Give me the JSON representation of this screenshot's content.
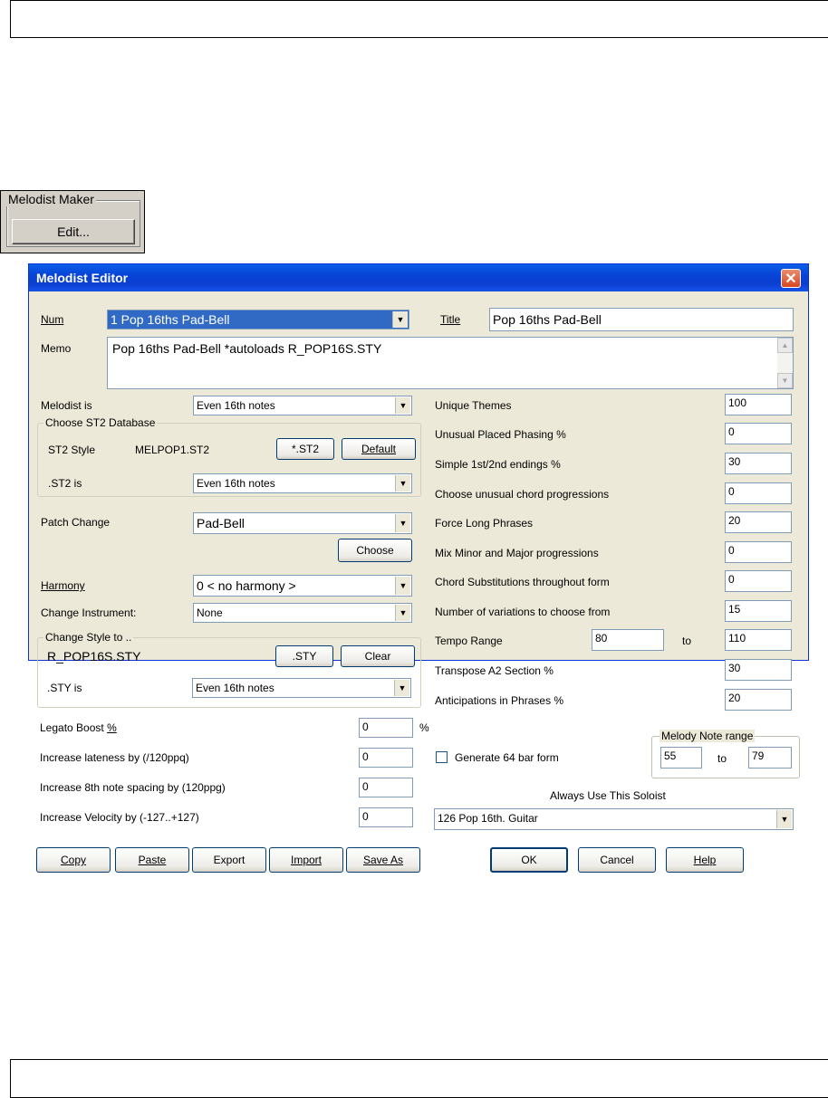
{
  "maker": {
    "legend": "Melodist Maker",
    "edit_label": "Edit..."
  },
  "dialog": {
    "title": "Melodist Editor",
    "close_glyph": "✕",
    "num": {
      "label": "Num",
      "value": "1 Pop 16ths Pad-Bell"
    },
    "title_field": {
      "label": "Title",
      "value": "Pop 16ths Pad-Bell"
    },
    "memo": {
      "label": "Memo",
      "value": "Pop 16ths Pad-Bell   *autoloads R_POP16S.STY"
    },
    "melodist_is": {
      "label": "Melodist is",
      "value": "Even 16th notes"
    },
    "st2": {
      "legend": "Choose ST2 Database",
      "style_label": "ST2 Style",
      "style_value": "MELPOP1.ST2",
      "st2_button": "*.ST2",
      "default_button": "Default",
      "is_label": ".ST2 is",
      "is_value": "Even 16th notes"
    },
    "patch": {
      "label": "Patch Change",
      "value": "Pad-Bell",
      "choose_button": "Choose"
    },
    "harmony": {
      "label": "Harmony",
      "value": "0 < no harmony >"
    },
    "change_instrument": {
      "label": "Change Instrument:",
      "value": "None"
    },
    "style": {
      "legend": "Change Style to ..",
      "value": "R_POP16S.STY",
      "sty_button": ".STY",
      "clear_button": "Clear",
      "is_label": ".STY is",
      "is_value": "Even 16th notes"
    },
    "legato": {
      "label": "Legato Boost %",
      "value": "0",
      "suffix": "%"
    },
    "lateness": {
      "label": "Increase lateness by (/120ppq)",
      "value": "0"
    },
    "spacing": {
      "label": "Increase 8th note spacing by (120ppg)",
      "value": "0"
    },
    "velocity": {
      "label": "Increase Velocity by (-127..+127)",
      "value": "0"
    },
    "right": {
      "unique_themes": {
        "label": "Unique Themes",
        "value": "100"
      },
      "unusual_phasing": {
        "label": "Unusual Placed Phasing %",
        "value": "0"
      },
      "simple_endings": {
        "label": "Simple 1st/2nd endings %",
        "value": "30"
      },
      "unusual_chords": {
        "label": "Choose unusual chord progressions",
        "value": "0"
      },
      "long_phrases": {
        "label": "Force Long Phrases",
        "value": "20"
      },
      "mix_minor": {
        "label": "Mix Minor and Major progressions",
        "value": "0"
      },
      "chord_subs": {
        "label": "Chord Substitutions throughout form",
        "value": "0"
      },
      "variations": {
        "label": "Number of variations to choose from",
        "value": "15"
      },
      "tempo": {
        "label": "Tempo Range",
        "from": "80",
        "to_label": "to",
        "to": "110"
      },
      "transpose": {
        "label": "Transpose A2 Section %",
        "value": "30"
      },
      "anticipations": {
        "label": "Anticipations in Phrases %",
        "value": "20"
      },
      "generate64": {
        "label": "Generate 64 bar form"
      },
      "note_range": {
        "legend": "Melody Note range",
        "from": "55",
        "to_label": "to",
        "to": "79"
      },
      "soloist": {
        "label": "Always Use This Soloist",
        "value": "126  Pop 16th. Guitar"
      }
    },
    "buttons": {
      "copy": "Copy",
      "paste": "Paste",
      "export": "Export",
      "import": "Import",
      "save_as": "Save As",
      "ok": "OK",
      "cancel": "Cancel",
      "help": "Help"
    }
  }
}
